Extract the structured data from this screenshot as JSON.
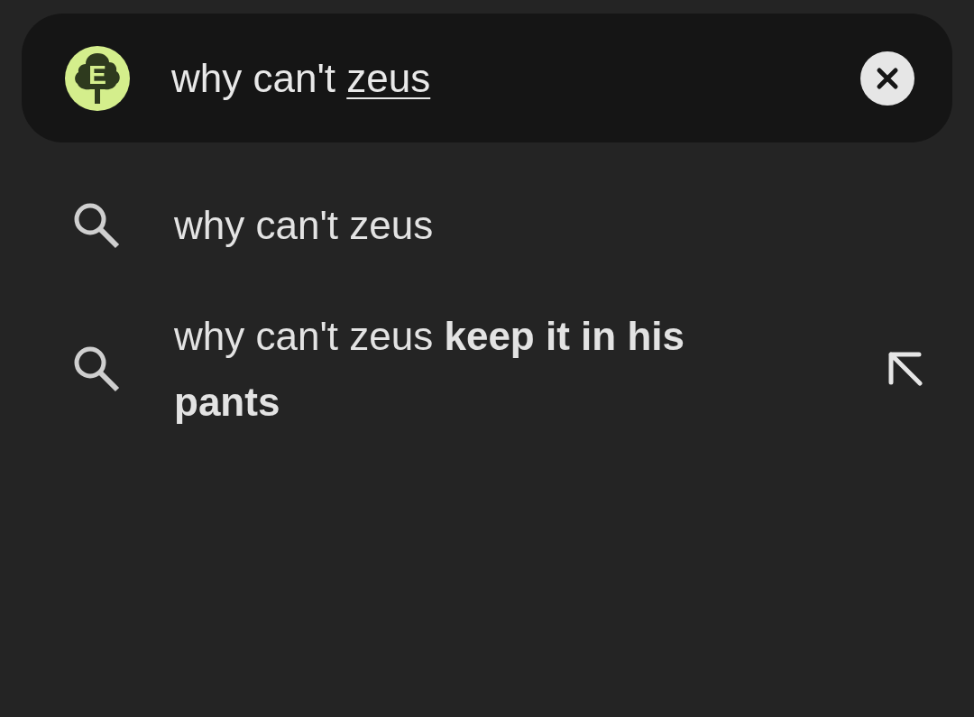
{
  "search_bar": {
    "logo": {
      "letter": "E"
    },
    "query": {
      "committed": "why can't",
      "composing": "zeus"
    }
  },
  "suggestions": [
    {
      "text": "why can't zeus",
      "has_fill_arrow": false
    },
    {
      "text": "why can't zeus **keep it in his pants**",
      "has_fill_arrow": true
    }
  ]
}
